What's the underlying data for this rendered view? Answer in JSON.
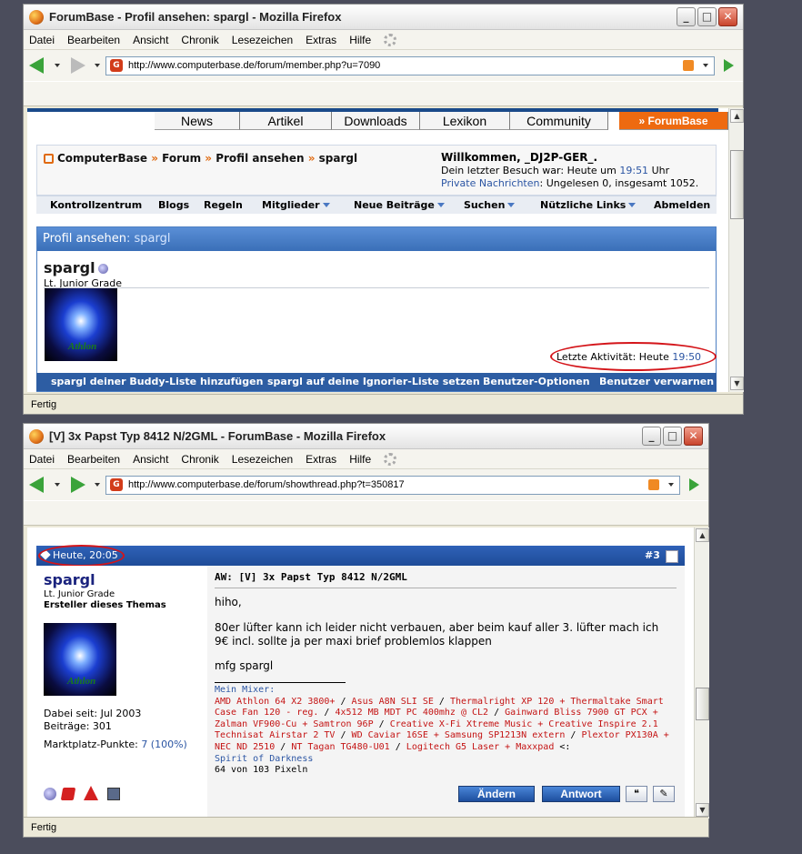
{
  "window1": {
    "title": "ForumBase - Profil ansehen: spargl - Mozilla Firefox",
    "menu": [
      "Datei",
      "Bearbeiten",
      "Ansicht",
      "Chronik",
      "Lesezeichen",
      "Extras",
      "Hilfe"
    ],
    "url": "http://www.computerbase.de/forum/member.php?u=7090",
    "status": "Fertig",
    "tabs": [
      "News",
      "Artikel",
      "Downloads",
      "Lexikon",
      "Community",
      "» ForumBase"
    ],
    "breadcrumb": {
      "home": "ComputerBase",
      "forum": "Forum",
      "profile": "Profil ansehen",
      "user": "spargl",
      "sep": "»"
    },
    "welcome": {
      "greeting": "Willkommen, _DJ2P-GER_.",
      "last_visit_label": "Dein letzter Besuch war: Heute um",
      "last_visit_time": "19:51",
      "last_visit_suffix": "Uhr",
      "pm_label": "Private Nachrichten",
      "pm_text": ": Ungelesen 0, insgesamt 1052."
    },
    "navlinks": [
      "Kontrollzentrum",
      "Blogs",
      "Regeln",
      "Mitglieder",
      "Neue Beiträge",
      "Suchen",
      "Nützliche Links",
      "Abmelden"
    ],
    "profile": {
      "header_label": "Profil ansehen",
      "header_user": ": spargl",
      "username": "spargl",
      "rank": "Lt. Junior Grade",
      "avatar_text": "Athlon",
      "last_activity_label": "Letzte Aktivität: Heute",
      "last_activity_time": "19:50",
      "actions": [
        "spargl deiner Buddy-Liste hinzufügen",
        "spargl auf deine Ignorier-Liste setzen",
        "Benutzer-Optionen",
        "Benutzer verwarnen"
      ]
    }
  },
  "window2": {
    "title": "[V] 3x Papst Typ 8412 N/2GML - ForumBase - Mozilla Firefox",
    "menu": [
      "Datei",
      "Bearbeiten",
      "Ansicht",
      "Chronik",
      "Lesezeichen",
      "Extras",
      "Hilfe"
    ],
    "url": "http://www.computerbase.de/forum/showthread.php?t=350817",
    "status": "Fertig",
    "post": {
      "date": "Heute, 20:05",
      "number": "#3",
      "username": "spargl",
      "rank": "Lt. Junior Grade",
      "starter": "Ersteller dieses Themas",
      "avatar_text": "Athlon",
      "joined": "Dabei seit: Jul 2003",
      "posts": "Beiträge: 301",
      "market_label": "Marktplatz-Punkte:",
      "market_value": "7 (100%)",
      "title": "AW: [V] 3x Papst Typ 8412 N/2GML",
      "lines": [
        "hiho,",
        "80er lüfter kann ich leider nicht verbauen, aber beim kauf aller 3. lüfter mach ich",
        "9€ incl. sollte ja per maxi brief problemlos klappen",
        "mfg spargl"
      ],
      "sig": {
        "mixer_label": "Mein Mixer:",
        "l1a": "AMD Athlon 64 X2 3800+",
        "l1b": "Asus A8N SLI SE",
        "l1c": "Thermalright XP 120 + Thermaltake Smart",
        "l2a": "Case Fan 120 - reg.",
        "l2b": "4x512 MB MDT PC 400mhz @ CL2",
        "l2c": "Gainward Bliss 7900 GT PCX +",
        "l3a": "Zalman VF900-Cu + Samtron 96P",
        "l3b": "Creative X-Fi Xtreme Music + Creative Inspire 2.1",
        "l4a": "Technisat Airstar 2 TV",
        "l4b": "WD Caviar 16SE + Samsung SP1213N extern",
        "l4c": "Plextor PX130A +",
        "l5a": "NEC ND 2510",
        "l5b": "NT Tagan TG480-U01",
        "l5c": "Logitech G5 Laser + Maxxpad",
        "l5d": "<:",
        "spirit": "Spirit of Darkness",
        "pixels": "64 von 103 Pixeln",
        "slash": "/"
      },
      "buttons": {
        "edit": "Ändern",
        "reply": "Antwort",
        "quote": "❝",
        "fast": "✎"
      }
    }
  },
  "colors": {
    "accent": "#2d5da3",
    "orange": "#ee6a10",
    "red": "#c41414",
    "highlight_oval": "#d4151a"
  }
}
